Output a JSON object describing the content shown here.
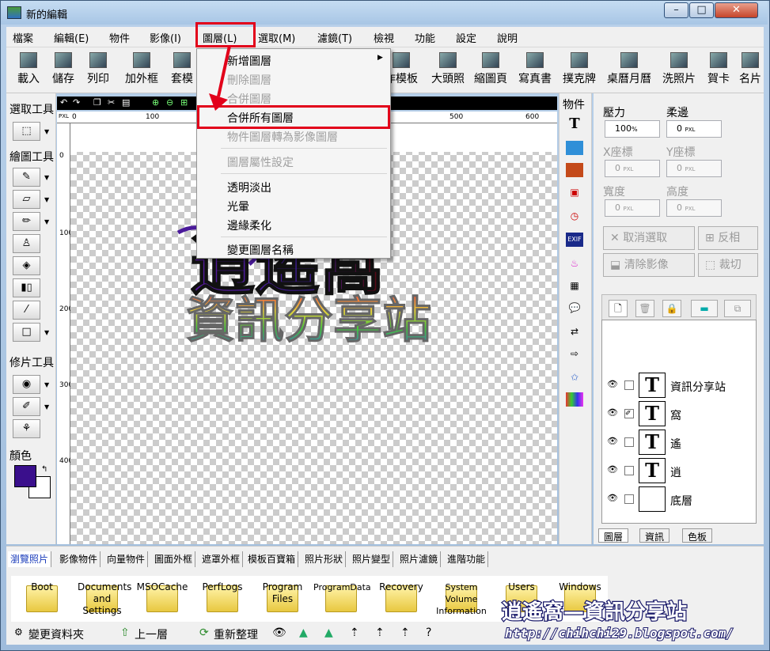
{
  "window": {
    "title": "新的編輯",
    "min_label": "–",
    "max_label": "□",
    "close_label": "✕"
  },
  "menubar": [
    "檔案",
    "編輯(E)",
    "物件",
    "影像(I)",
    "圖層(L)",
    "選取(M)",
    "濾鏡(T)",
    "檢視",
    "功能",
    "設定",
    "說明"
  ],
  "toolbar": [
    "載入",
    "儲存",
    "列印",
    "加外框",
    "套模",
    "作模板",
    "大頭照",
    "縮圖頁",
    "寫真書",
    "撲克牌",
    "桌曆月曆",
    "洗照片",
    "賀卡",
    "名片"
  ],
  "left_panel": {
    "select_title": "選取工具",
    "draw_title": "繪圖工具",
    "retouch_title": "修片工具",
    "color_title": "顏色",
    "fg_color": "#3a0f8c",
    "bg_color": "#ffffff"
  },
  "ruler": {
    "top": [
      "0",
      "100",
      "500",
      "600"
    ],
    "left": [
      "0",
      "100",
      "200",
      "300",
      "400"
    ],
    "unit": "PXL"
  },
  "objects_title": "物件",
  "right_panel": {
    "pressure_label": "壓力",
    "pressure_value": "100",
    "pressure_unit": "%",
    "soft_label": "柔邊",
    "soft_value": "0",
    "soft_unit": "PXL",
    "x_label": "X座標",
    "x_value": "0",
    "x_unit": "PXL",
    "y_label": "Y座標",
    "y_value": "0",
    "y_unit": "PXL",
    "w_label": "寬度",
    "w_value": "0",
    "w_unit": "PXL",
    "h_label": "高度",
    "h_value": "0",
    "h_unit": "PXL",
    "deselect": "取消選取",
    "invert": "反相",
    "clear": "清除影像",
    "crop": "裁切"
  },
  "layers": [
    {
      "name": "資訊分享站",
      "thumb": "T"
    },
    {
      "name": "窩",
      "thumb": "T"
    },
    {
      "name": "遙",
      "thumb": "T"
    },
    {
      "name": "逍",
      "thumb": "T"
    },
    {
      "name": "底層",
      "thumb": ""
    }
  ],
  "right_tabs": [
    "圖層",
    "資訊",
    "色板"
  ],
  "bottom_tabs": [
    "瀏覽照片",
    "影像物件",
    "向量物件",
    "圖面外框",
    "遮罩外框",
    "模板百寶箱",
    "照片形狀",
    "照片變型",
    "照片濾鏡",
    "進階功能"
  ],
  "folders": [
    "Boot",
    "Documents and Settings",
    "MSOCache",
    "PerfLogs",
    "Program Files",
    "ProgramData",
    "Recovery",
    "System Volume Information",
    "Users",
    "Windows"
  ],
  "status": {
    "change_folder": "變更資料夾",
    "up": "上一層",
    "refresh": "重新整理"
  },
  "dropdown": [
    {
      "label": "新增圖層",
      "disabled": false,
      "submenu": true
    },
    {
      "label": "刪除圖層",
      "disabled": true
    },
    {
      "label": "合併圖層",
      "disabled": true
    },
    {
      "label": "合併所有圖層",
      "disabled": false
    },
    {
      "label": "物件圖層轉為影像圖層",
      "disabled": true
    },
    {
      "label": "圖層屬性設定",
      "disabled": true
    },
    {
      "label": "透明淡出",
      "disabled": false
    },
    {
      "label": "光暈",
      "disabled": false
    },
    {
      "label": "邊緣柔化",
      "disabled": false
    },
    {
      "label": "變更圖層名稱",
      "disabled": false
    }
  ],
  "watermark": {
    "title": "逍遙窩—資訊分享站",
    "url": "http://chihchi29.blogspot.com/"
  },
  "canvas_text": {
    "top": "逍遙窩",
    "bottom": "資訊分享站"
  },
  "colors": {
    "highlight": "#e2001a",
    "accent_dark": "#3a0f8c"
  }
}
